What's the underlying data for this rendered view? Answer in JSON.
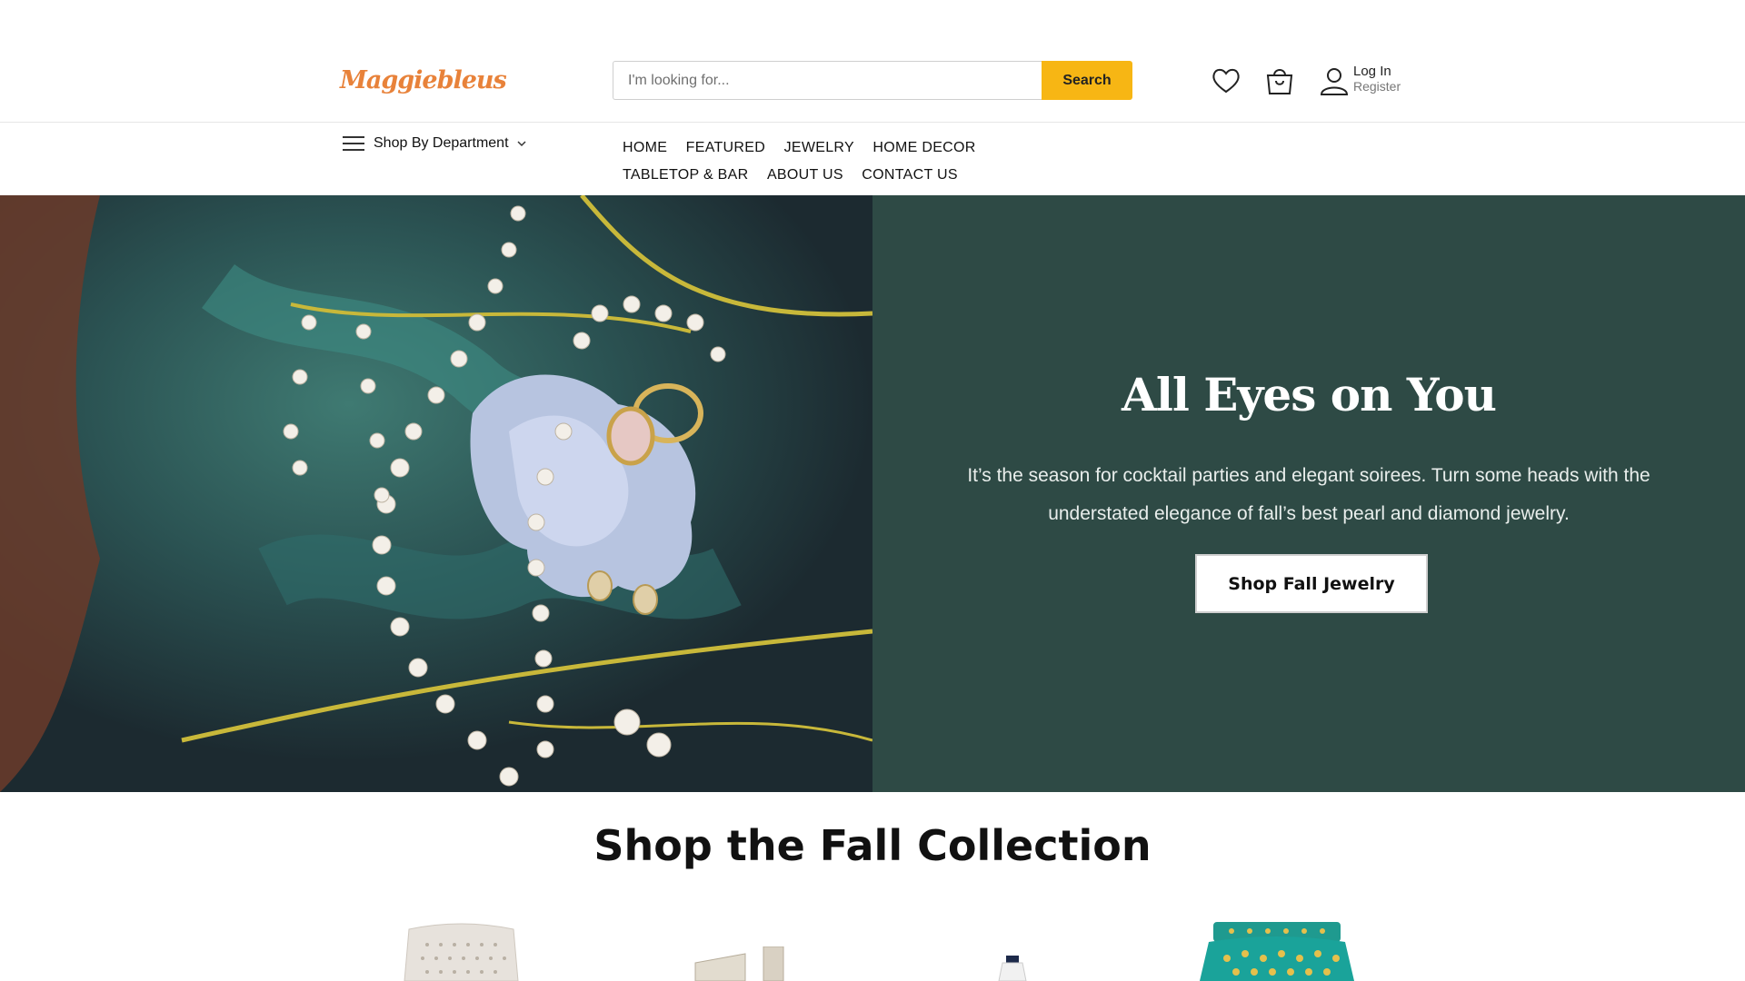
{
  "header": {
    "logo_text": "Maggiebleus",
    "search": {
      "placeholder": "I'm looking for...",
      "value": "",
      "button_label": "Search"
    },
    "account": {
      "login_label": "Log In",
      "register_label": "Register"
    },
    "icons": [
      "heart-icon",
      "shopping-bag-icon",
      "user-icon",
      "menu-icon",
      "chevron-down-icon"
    ]
  },
  "nav": {
    "department_label": "Shop By Department",
    "items": [
      "HOME",
      "FEATURED",
      "JEWELRY",
      "HOME DECOR",
      "TABLETOP & BAR",
      "ABOUT US",
      "CONTACT US"
    ]
  },
  "hero": {
    "title": "All Eyes on You",
    "text": "It’s the season for cocktail parties and elegant soirees. Turn some heads with the understated elegance of fall’s best pearl and diamond jewelry.",
    "button_label": "Shop Fall Jewelry",
    "panel_color": "#2e4a45"
  },
  "collection": {
    "title": "Shop the Fall Collection"
  },
  "colors": {
    "accent": "#f7b614",
    "logo": "#e8823a"
  }
}
